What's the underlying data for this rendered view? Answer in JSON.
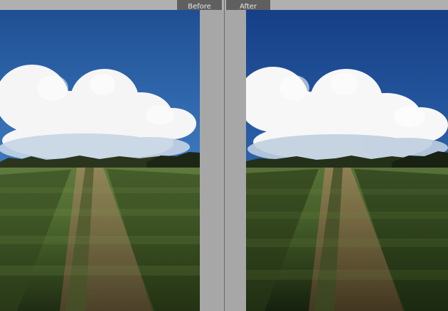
{
  "compare_view": {
    "before_label": "Before",
    "after_label": "After"
  }
}
